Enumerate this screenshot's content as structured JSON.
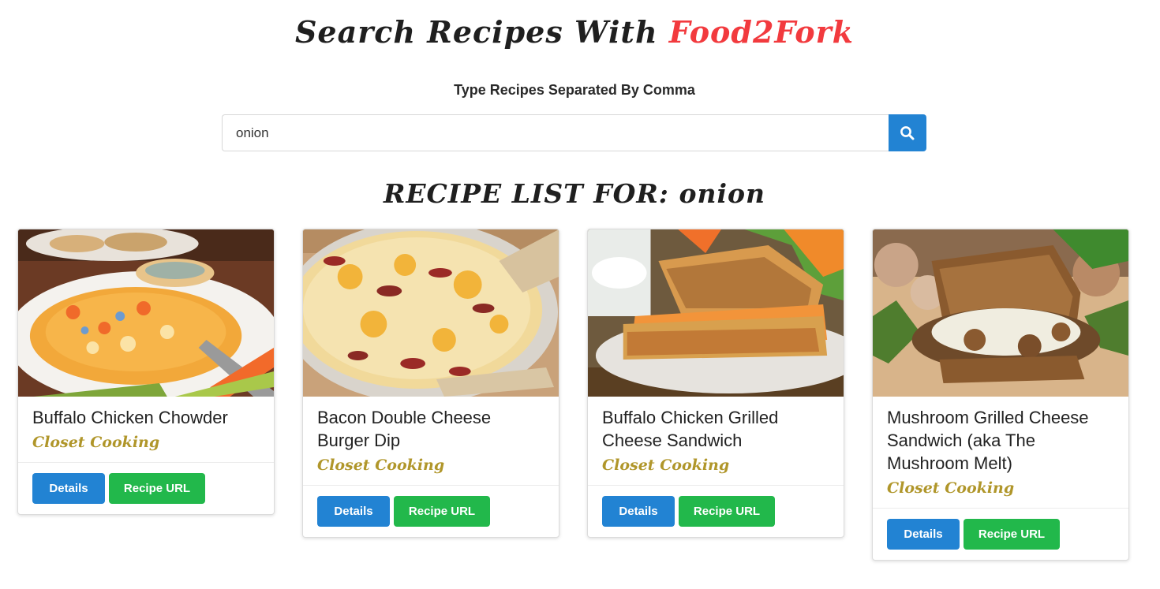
{
  "header": {
    "title_prefix": "Search Recipes With ",
    "title_brand": "Food2Fork",
    "subtitle": "Type Recipes Separated By Comma"
  },
  "search": {
    "value": "onion",
    "icon": "search-icon"
  },
  "list": {
    "heading_prefix": "RECIPE LIST FOR: ",
    "query": "onion"
  },
  "colors": {
    "brand": "#f23a3e",
    "primary": "#2283d3",
    "success": "#22b84b",
    "publisher": "#b0962a"
  },
  "recipes": [
    {
      "title": "Buffalo Chicken Chowder",
      "publisher": "Closet Cooking",
      "details_label": "Details",
      "url_label": "Recipe URL",
      "image": "buffalo-chicken-chowder-photo"
    },
    {
      "title": "Bacon Double Cheese Burger Dip",
      "publisher": "Closet Cooking",
      "details_label": "Details",
      "url_label": "Recipe URL",
      "image": "bacon-cheese-dip-photo"
    },
    {
      "title": "Buffalo Chicken Grilled Cheese Sandwich",
      "publisher": "Closet Cooking",
      "details_label": "Details",
      "url_label": "Recipe URL",
      "image": "grilled-cheese-sandwich-photo"
    },
    {
      "title": "Mushroom Grilled Cheese Sandwich (aka The Mushroom Melt)",
      "publisher": "Closet Cooking",
      "details_label": "Details",
      "url_label": "Recipe URL",
      "image": "mushroom-melt-photo"
    }
  ]
}
